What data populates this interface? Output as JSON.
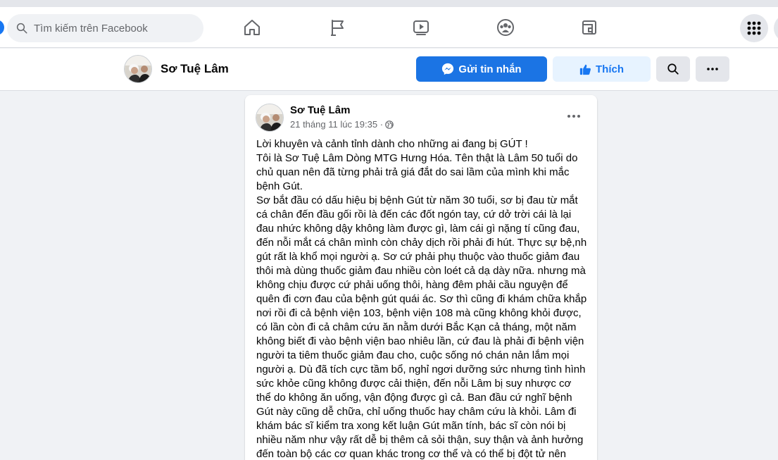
{
  "topbar": {
    "search_placeholder": "Tìm kiếm trên Facebook",
    "nav_icons": [
      "home-icon",
      "pages-flag-icon",
      "watch-video-icon",
      "groups-icon",
      "gaming-icon"
    ],
    "menu_icon": "grid-menu-icon"
  },
  "profile": {
    "name": "Sơ Tuệ Lâm",
    "message_label": "Gửi tin nhắn",
    "like_label": "Thích"
  },
  "post": {
    "author": "Sơ Tuệ Lâm",
    "timestamp": "21 tháng 11 lúc 19:35 ·",
    "privacy_icon": "globe-icon",
    "body": "Lời khuyên và cảnh tỉnh dành cho những ai đang bị GÚT !\nTôi là Sơ Tuệ Lâm Dòng MTG Hưng Hóa. Tên thật là Lâm 50 tuổi do chủ quan nên đã từng phải trả giá đắt do sai lầm của mình khi mắc bệnh Gút.\nSơ bắt đầu có dấu hiệu bị bệnh Gút từ năm 30 tuổi, sơ bị đau từ mắt cá chân đến đầu gối rồi là đến các đốt ngón tay, cứ dở trời cái là lại đau nhức không dậy không làm được gì, làm cái gì nặng tí cũng đau, đến nỗi mắt cá chân mình còn chảy dịch rồi phải đi hút. Thực sự bệ,nh gút rất là khổ mọi người ạ. Sơ cứ phải phụ thuộc vào thuốc giảm đau thôi mà dùng thuốc giảm đau nhiều còn loét cả dạ dày nữa. nhưng mà không chịu được cứ phải uống thôi, hàng đêm phải cầu nguyện để quên đi cơn đau của bệnh gút quái ác. Sơ thì cũng đi khám chữa khắp nơi rồi đi cả bệnh viện 103, bệnh viện 108 mà cũng không khỏi được, có lần còn đi cả châm cứu ăn nằm dưới Bắc Kạn cả tháng, một năm không biết đi vào bệnh viện bao nhiêu lần, cứ đau là phải đi bệnh viện người ta tiêm thuốc giảm đau cho, cuộc sống nó chán nản lắm mọi người ạ. Dù đã tích cực tầm bổ, nghỉ ngơi dưỡng sức nhưng tình hình sức khỏe cũng không được cải thiện, đến nỗi Lâm bị suy nhược cơ thể do không ăn uống, vận động được gì cả. Ban đầu cứ nghĩ bệnh Gút này cũng dễ chữa, chỉ uống thuốc hay châm cứu là khỏi. Lâm đi khám bác sĩ kiểm tra xong kết luận Gút mãn tính, bác sĩ còn nói bị nhiều năm như vậy rất dễ bị thêm cả sỏi thận, suy thận và ảnh hưởng đến toàn bộ các cơ quan khác trong cơ thể và có thể bị đột tử nên Lâm"
  },
  "colors": {
    "brand_blue": "#1877f2",
    "message_button": "#1b74e4",
    "like_button_bg": "#e7f3ff",
    "page_bg": "#f0f2f5"
  }
}
